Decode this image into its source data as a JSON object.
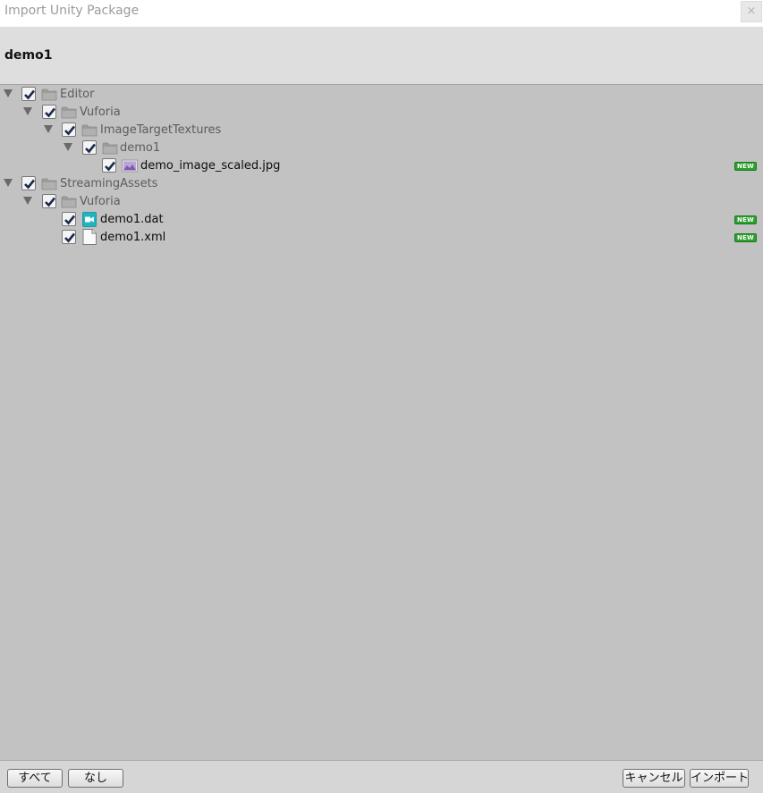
{
  "window": {
    "title": "Import Unity Package",
    "close_label": "×"
  },
  "header": {
    "package_name": "demo1"
  },
  "tree": {
    "items": [
      {
        "label": "Editor",
        "type": "folder",
        "checked": true,
        "expanded": true,
        "is_new": false
      },
      {
        "label": "Vuforia",
        "type": "folder",
        "checked": true,
        "expanded": true,
        "is_new": false
      },
      {
        "label": "ImageTargetTextures",
        "type": "folder",
        "checked": true,
        "expanded": true,
        "is_new": false
      },
      {
        "label": "demo1",
        "type": "folder",
        "checked": true,
        "expanded": true,
        "is_new": false
      },
      {
        "label": "demo_image_scaled.jpg",
        "type": "image-file",
        "checked": true,
        "is_new": true,
        "badge": "NEW"
      },
      {
        "label": "StreamingAssets",
        "type": "folder",
        "checked": true,
        "expanded": true,
        "is_new": false
      },
      {
        "label": "Vuforia",
        "type": "folder",
        "checked": true,
        "expanded": true,
        "is_new": false
      },
      {
        "label": "demo1.dat",
        "type": "dat-file",
        "checked": true,
        "is_new": true,
        "badge": "NEW"
      },
      {
        "label": "demo1.xml",
        "type": "text-file",
        "checked": true,
        "is_new": true,
        "badge": "NEW"
      }
    ]
  },
  "footer": {
    "select_all_label": "すべて",
    "select_none_label": "なし",
    "cancel_label": "キャンセル",
    "import_label": "インポート"
  },
  "colors": {
    "background": "#c2c2c2",
    "header": "#dedede",
    "new_badge": "#2f9f2f",
    "dat_icon": "#1cb5c0"
  },
  "icons": {
    "folder": "folder-icon",
    "image": "image-file-icon",
    "dat": "dat-file-icon",
    "text": "text-file-icon",
    "arrow": "expand-arrow-icon",
    "check": "checkmark-icon"
  }
}
